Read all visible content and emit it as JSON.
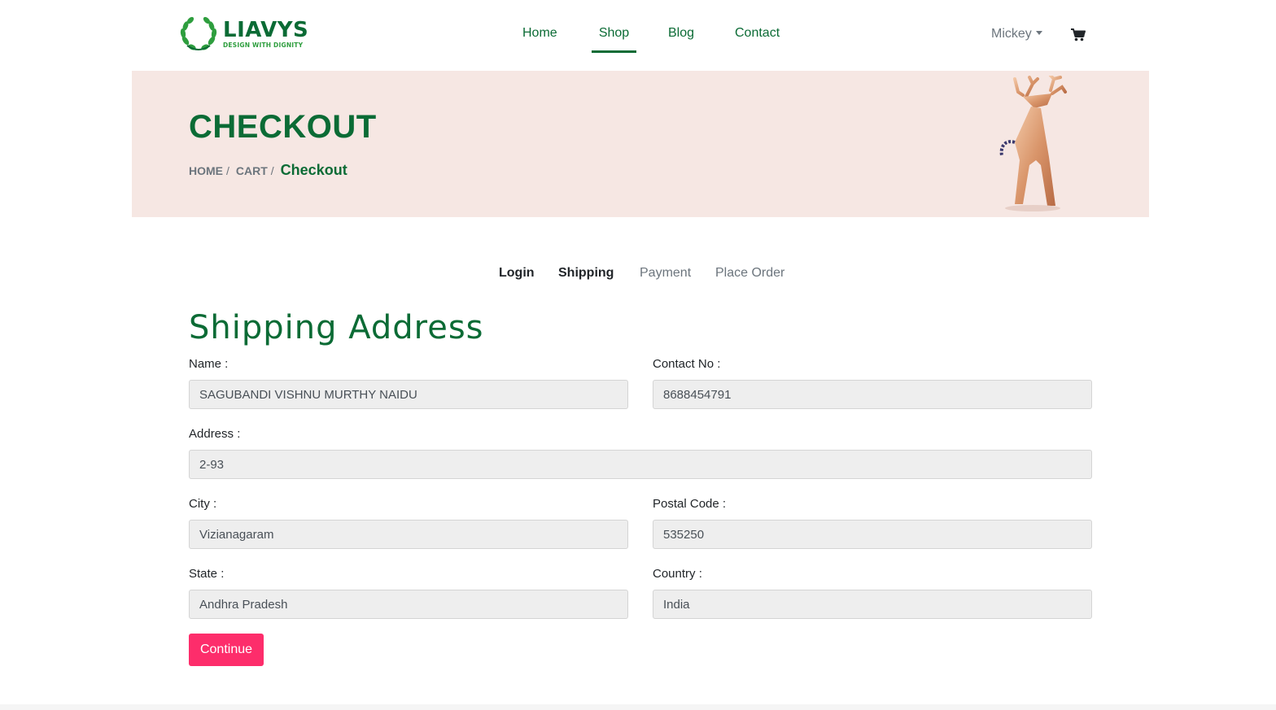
{
  "brand": {
    "name": "LIAVYS",
    "tagline": "DESIGN WITH DIGNITY",
    "color": "#0b6b35"
  },
  "nav": {
    "links": [
      {
        "label": "Home",
        "active": false
      },
      {
        "label": "Shop",
        "active": true
      },
      {
        "label": "Blog",
        "active": false
      },
      {
        "label": "Contact",
        "active": false
      }
    ],
    "user": "Mickey",
    "cart_icon": "shopping-cart-icon"
  },
  "hero": {
    "title": "CHECKOUT",
    "breadcrumb": [
      {
        "label": "HOME"
      },
      {
        "label": "CART"
      }
    ],
    "breadcrumb_current": "Checkout",
    "separator": "/",
    "image_icon": "deer-figurine-image"
  },
  "steps": [
    {
      "label": "Login",
      "done": true
    },
    {
      "label": "Shipping",
      "done": true
    },
    {
      "label": "Payment",
      "done": false
    },
    {
      "label": "Place Order",
      "done": false
    }
  ],
  "form": {
    "title": "Shipping Address",
    "name": {
      "label": "Name :",
      "value": "SAGUBANDI VISHNU MURTHY NAIDU"
    },
    "contact": {
      "label": "Contact No :",
      "value": "8688454791"
    },
    "address": {
      "label": "Address :",
      "value": "2-93"
    },
    "city": {
      "label": "City :",
      "value": "Vizianagaram"
    },
    "postal": {
      "label": "Postal Code :",
      "value": "535250"
    },
    "state": {
      "label": "State :",
      "value": "Andhra Pradesh"
    },
    "country": {
      "label": "Country :",
      "value": "India"
    },
    "submit_label": "Continue",
    "submit_color": "#fd2d6b"
  }
}
